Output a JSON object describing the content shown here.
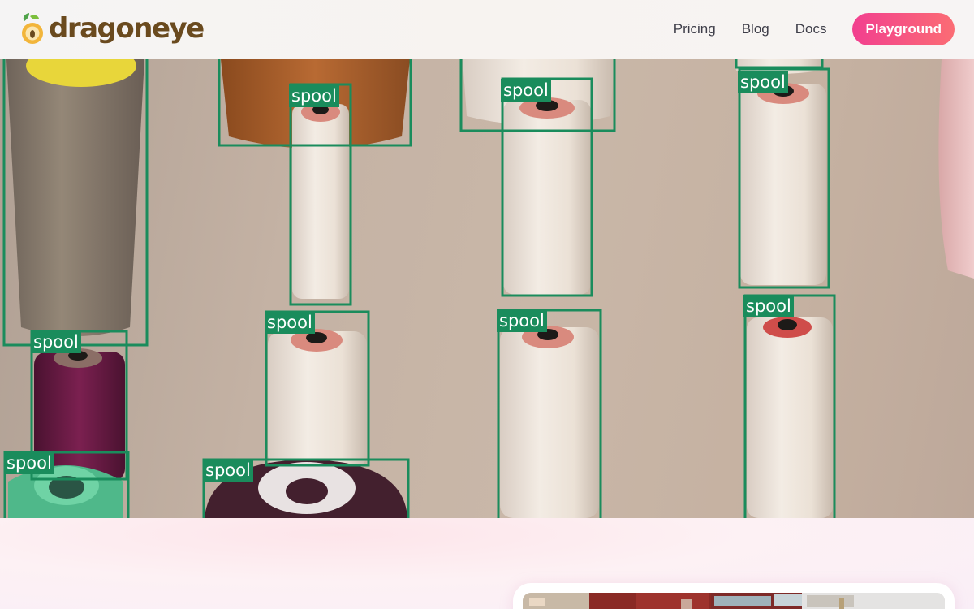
{
  "header": {
    "brand": "dragoneye",
    "nav": [
      {
        "label": "Pricing"
      },
      {
        "label": "Blog"
      },
      {
        "label": "Docs"
      }
    ],
    "cta_label": "Playground"
  },
  "hero": {
    "detection_label": "spool",
    "detection_color": "#1a8c5c"
  },
  "colors": {
    "brand_text": "#6a4a1e",
    "cta_gradient_start": "#f23f8f",
    "cta_gradient_end": "#fb6c74"
  }
}
